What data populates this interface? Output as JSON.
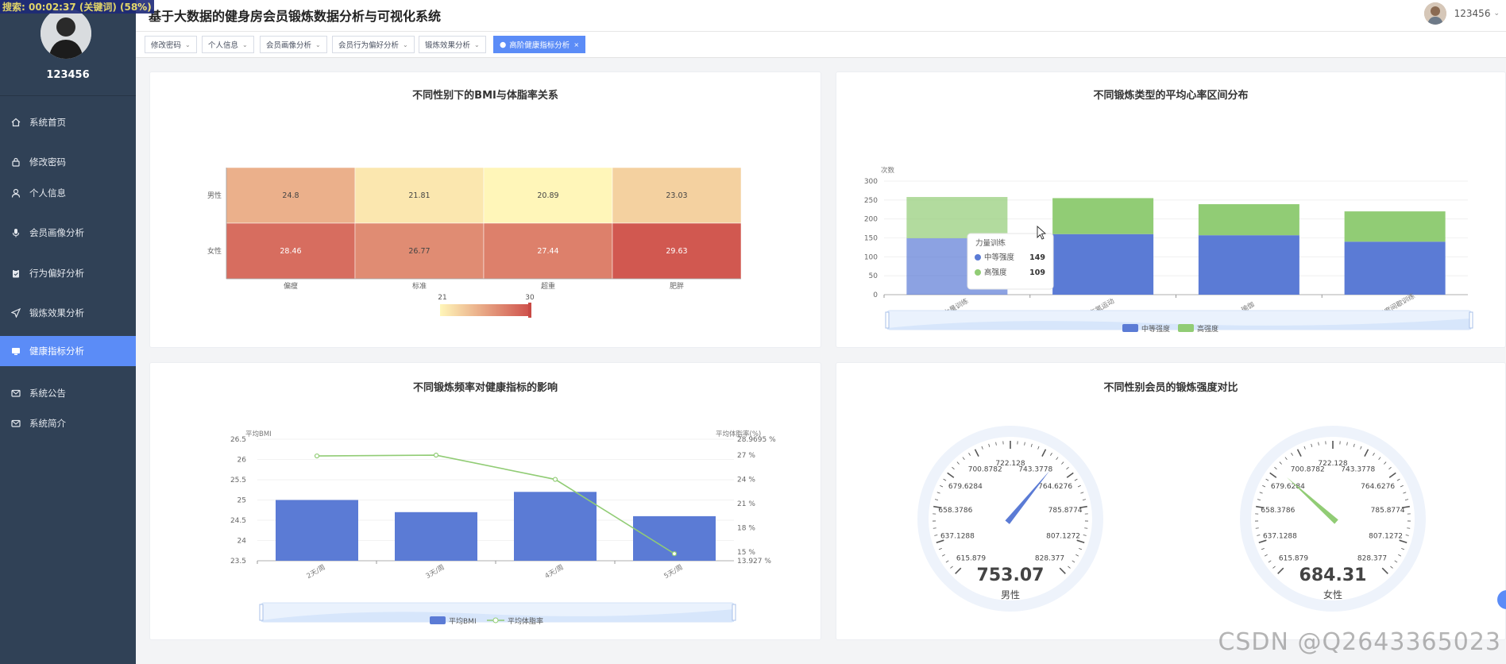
{
  "overlay": {
    "search_text": "搜索:  00:02:37 (关键词) (58%)"
  },
  "header": {
    "title": "基于大数据的健身房会员锻炼数据分析与可视化系统",
    "username": "123456"
  },
  "sidebar": {
    "username": "123456",
    "items": [
      {
        "label": "系统首页",
        "icon": "home-icon"
      },
      {
        "label": "修改密码",
        "icon": "lock-icon"
      },
      {
        "label": "个人信息",
        "icon": "user-icon"
      },
      {
        "label": "会员画像分析",
        "icon": "mic-icon"
      },
      {
        "label": "行为偏好分析",
        "icon": "clipboard-icon"
      },
      {
        "label": "锻炼效果分析",
        "icon": "send-icon"
      },
      {
        "label": "健康指标分析",
        "icon": "monitor-icon"
      },
      {
        "label": "系统公告",
        "icon": "mail-icon"
      },
      {
        "label": "系统简介",
        "icon": "mail-icon"
      }
    ]
  },
  "tabs": [
    {
      "label": "修改密码"
    },
    {
      "label": "个人信息"
    },
    {
      "label": "会员画像分析"
    },
    {
      "label": "会员行为偏好分析"
    },
    {
      "label": "锻炼效果分析"
    },
    {
      "label": "高阶健康指标分析"
    }
  ],
  "watermark": "CSDN @Q2643365023",
  "colors": {
    "sidebar": "#304156",
    "accent": "#5b8cf7",
    "bar_blue": "#5b7bd5",
    "bar_green": "#91cc75"
  },
  "chart_data": [
    {
      "type": "heatmap",
      "title": "不同性别下的BMI与体脂率关系",
      "x_categories": [
        "偏瘦",
        "标准",
        "超重",
        "肥胖"
      ],
      "y_categories": [
        "男性",
        "女性"
      ],
      "values": [
        [
          24.8,
          21.81,
          20.89,
          23.03
        ],
        [
          28.46,
          26.77,
          27.44,
          29.63
        ]
      ],
      "visual_map": {
        "min": 21,
        "max": 30,
        "min_label": "21",
        "max_label": "30"
      }
    },
    {
      "type": "bar",
      "stacked": true,
      "title": "不同锻炼类型的平均心率区间分布",
      "ylabel": "次数",
      "ylim": [
        0,
        300
      ],
      "yticks": [
        "0",
        "50",
        "100",
        "150",
        "200",
        "250",
        "300"
      ],
      "categories": [
        "力量训练",
        "有氧运动",
        "瑜伽",
        "高强度间歇训练"
      ],
      "series": [
        {
          "name": "中等强度",
          "values": [
            149,
            160,
            157,
            140
          ]
        },
        {
          "name": "高强度",
          "values": [
            109,
            95,
            82,
            80
          ]
        }
      ],
      "legend": "bottom",
      "tooltip": {
        "title": "力量训练",
        "rows": [
          {
            "name": "中等强度",
            "value": "149"
          },
          {
            "name": "高强度",
            "value": "109"
          }
        ]
      }
    },
    {
      "type": "bar",
      "title": "不同锻炼频率对健康指标的影响",
      "ylabel_left": "平均BMI",
      "ylabel_right": "平均体脂率(%)",
      "left_ticks": [
        "26.5",
        "26",
        "25.5",
        "25",
        "24.5",
        "24",
        "23.5"
      ],
      "right_ticks": [
        "28.9695 %",
        "27 %",
        "24 %",
        "21 %",
        "18 %",
        "15 %",
        "13.927 %"
      ],
      "left_range": [
        23.5,
        26.5
      ],
      "right_range": [
        13.927,
        28.9695
      ],
      "categories": [
        "2天/周",
        "3天/周",
        "4天/周",
        "5天/周"
      ],
      "series": [
        {
          "name": "平均BMI",
          "type": "bar",
          "values": [
            25.0,
            24.7,
            25.2,
            24.6
          ]
        },
        {
          "name": "平均体脂率",
          "type": "line",
          "values": [
            26.9,
            27.0,
            24.0,
            14.8
          ]
        }
      ],
      "legend": "bottom"
    },
    {
      "type": "gauge",
      "title": "不同性别会员的锻炼强度对比",
      "min": 615.879,
      "max": 828.377,
      "scale_labels": [
        "615.879",
        "637.1288",
        "658.3786",
        "679.6284",
        "700.8782",
        "722.128",
        "743.3778",
        "764.6276",
        "785.8774",
        "807.1272",
        "828.377"
      ],
      "gauges": [
        {
          "label": "男性",
          "value": 753.07,
          "value_text": "753.07",
          "color": "#5b7bd5"
        },
        {
          "label": "女性",
          "value": 684.31,
          "value_text": "684.31",
          "color": "#91cc75"
        }
      ]
    }
  ]
}
